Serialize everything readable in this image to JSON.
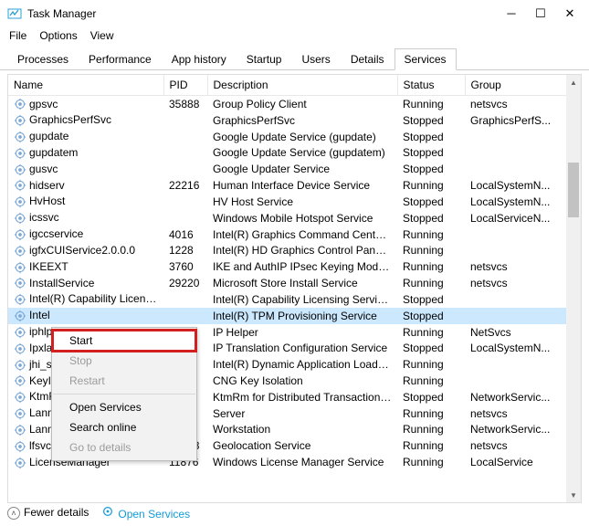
{
  "window": {
    "title": "Task Manager"
  },
  "menu": [
    "File",
    "Options",
    "View"
  ],
  "tabs": [
    "Processes",
    "Performance",
    "App history",
    "Startup",
    "Users",
    "Details",
    "Services"
  ],
  "active_tab": "Services",
  "columns": [
    "Name",
    "PID",
    "Description",
    "Status",
    "Group"
  ],
  "rows": [
    {
      "name": "gpsvc",
      "pid": "35888",
      "desc": "Group Policy Client",
      "status": "Running",
      "group": "netsvcs"
    },
    {
      "name": "GraphicsPerfSvc",
      "pid": "",
      "desc": "GraphicsPerfSvc",
      "status": "Stopped",
      "group": "GraphicsPerfS..."
    },
    {
      "name": "gupdate",
      "pid": "",
      "desc": "Google Update Service (gupdate)",
      "status": "Stopped",
      "group": ""
    },
    {
      "name": "gupdatem",
      "pid": "",
      "desc": "Google Update Service (gupdatem)",
      "status": "Stopped",
      "group": ""
    },
    {
      "name": "gusvc",
      "pid": "",
      "desc": "Google Updater Service",
      "status": "Stopped",
      "group": ""
    },
    {
      "name": "hidserv",
      "pid": "22216",
      "desc": "Human Interface Device Service",
      "status": "Running",
      "group": "LocalSystemN..."
    },
    {
      "name": "HvHost",
      "pid": "",
      "desc": "HV Host Service",
      "status": "Stopped",
      "group": "LocalSystemN..."
    },
    {
      "name": "icssvc",
      "pid": "",
      "desc": "Windows Mobile Hotspot Service",
      "status": "Stopped",
      "group": "LocalServiceN..."
    },
    {
      "name": "igccservice",
      "pid": "4016",
      "desc": "Intel(R) Graphics Command Center ...",
      "status": "Running",
      "group": ""
    },
    {
      "name": "igfxCUIService2.0.0.0",
      "pid": "1228",
      "desc": "Intel(R) HD Graphics Control Panel S...",
      "status": "Running",
      "group": ""
    },
    {
      "name": "IKEEXT",
      "pid": "3760",
      "desc": "IKE and AuthIP IPsec Keying Modules",
      "status": "Running",
      "group": "netsvcs"
    },
    {
      "name": "InstallService",
      "pid": "29220",
      "desc": "Microsoft Store Install Service",
      "status": "Running",
      "group": "netsvcs"
    },
    {
      "name": "Intel(R) Capability Licensin...",
      "pid": "",
      "desc": "Intel(R) Capability Licensing Service ...",
      "status": "Stopped",
      "group": ""
    },
    {
      "name": "Intel",
      "pid": "",
      "desc": "Intel(R) TPM Provisioning Service",
      "status": "Stopped",
      "group": "",
      "selected": true
    },
    {
      "name": "iphlp",
      "pid": "",
      "desc": "IP Helper",
      "status": "Running",
      "group": "NetSvcs"
    },
    {
      "name": "IpxlatCfgSvc",
      "pid": "",
      "desc": "IP Translation Configuration Service",
      "status": "Stopped",
      "group": "LocalSystemN..."
    },
    {
      "name": "jhi_service",
      "pid": "",
      "desc": "Intel(R) Dynamic Application Loader...",
      "status": "Running",
      "group": ""
    },
    {
      "name": "KeyIso",
      "pid": "",
      "desc": "CNG Key Isolation",
      "status": "Running",
      "group": ""
    },
    {
      "name": "KtmRm",
      "pid": "",
      "desc": "KtmRm for Distributed Transaction C...",
      "status": "Stopped",
      "group": "NetworkServic..."
    },
    {
      "name": "LanmanServer",
      "pid": "",
      "desc": "Server",
      "status": "Running",
      "group": "netsvcs"
    },
    {
      "name": "LanmanWorkstation",
      "pid": "",
      "desc": "Workstation",
      "status": "Running",
      "group": "NetworkServic..."
    },
    {
      "name": "lfsvc",
      "pid": "10928",
      "desc": "Geolocation Service",
      "status": "Running",
      "group": "netsvcs"
    },
    {
      "name": "LicenseManager",
      "pid": "11876",
      "desc": "Windows License Manager Service",
      "status": "Running",
      "group": "LocalService"
    }
  ],
  "context_menu": {
    "start": "Start",
    "stop": "Stop",
    "restart": "Restart",
    "open_services": "Open Services",
    "search_online": "Search online",
    "go_to_details": "Go to details"
  },
  "footer": {
    "fewer": "Fewer details",
    "open_services": "Open Services"
  }
}
